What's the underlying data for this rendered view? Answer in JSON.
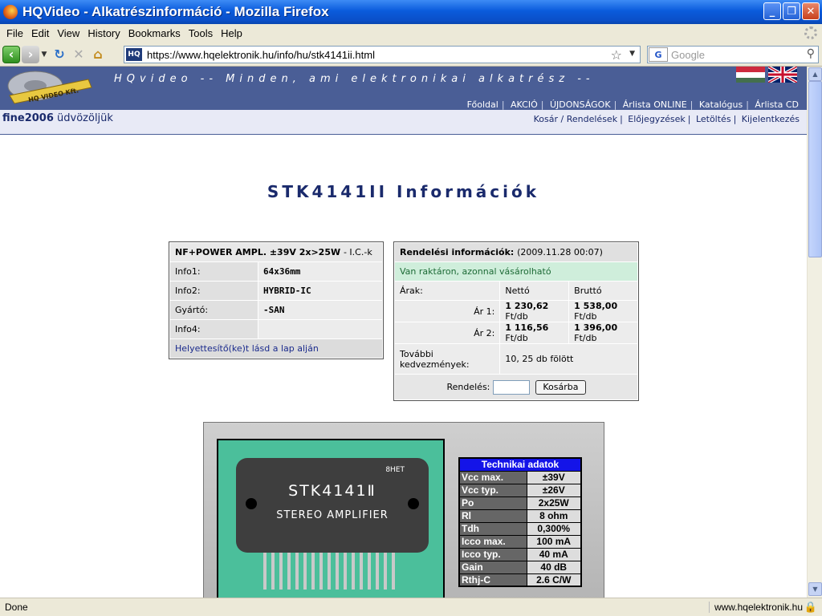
{
  "window": {
    "title": "HQVideo - Alkatrészinformáció - Mozilla Firefox",
    "minimize_icon": "minimize-icon",
    "maximize_icon": "restore-icon",
    "close_icon": "close-icon"
  },
  "menu": [
    "File",
    "Edit",
    "View",
    "History",
    "Bookmarks",
    "Tools",
    "Help"
  ],
  "toolbar": {
    "url": "https://www.hqelektronik.hu/info/hu/stk4141ii.html",
    "site_badge": "HQ",
    "search_engine": "G",
    "search_placeholder": "Google"
  },
  "site": {
    "slogan": "HQvideo -- Minden, ami elektronikai alkatrész --",
    "logo_text": "HQ VIDEO Kft.",
    "top_nav": [
      "Főoldal",
      "AKCIÓ",
      "ÚJDONSÁGOK",
      "Árlista ONLINE",
      "Katalógus",
      "Árlista CD"
    ],
    "user_name": "fine2006",
    "welcome": "üdvözöljük",
    "user_nav": [
      "Kosár / Rendelések",
      "Előjegyzések",
      "Letöltés",
      "Kijelentkezés"
    ]
  },
  "page_title": "STK4141II Információk",
  "info": {
    "header": "NF+POWER AMPL. ±39V 2x>25W",
    "header_suffix": "- I.C.-k",
    "rows": [
      {
        "label": "Info1:",
        "value": "64x36mm"
      },
      {
        "label": "Info2:",
        "value": "HYBRID-IC"
      },
      {
        "label": "Gyártó:",
        "value": "-SAN"
      },
      {
        "label": "Info4:",
        "value": ""
      }
    ],
    "link": "Helyettesítő(ke)t lásd a lap alján"
  },
  "order": {
    "header": "Rendelési információk:",
    "header_date": "(2009.11.28 00:07)",
    "stock": "Van raktáron, azonnal vásárolható",
    "prices_label": "Árak:",
    "net_label": "Nettó",
    "gross_label": "Bruttó",
    "rows": [
      {
        "label": "Ár 1:",
        "net": "1 230,62",
        "net_unit": "Ft/db",
        "gross": "1 538,00",
        "gross_unit": "Ft/db"
      },
      {
        "label": "Ár 2:",
        "net": "1 116,56",
        "net_unit": "Ft/db",
        "gross": "1 396,00",
        "gross_unit": "Ft/db"
      }
    ],
    "discount_label": "További kedvezmények:",
    "discount_value": "10, 25 db fölött",
    "order_label": "Rendelés:",
    "cart_button": "Kosárba"
  },
  "product_image": {
    "chip_text": "STK4141Ⅱ",
    "chip_subtext": "STEREO AMPLIFIER",
    "chip_code": "8HET"
  },
  "tech": {
    "header": "Technikai adatok",
    "rows": [
      {
        "k": "Vcc max.",
        "v": "±39V"
      },
      {
        "k": "Vcc typ.",
        "v": "±26V"
      },
      {
        "k": "Po",
        "v": "2x25W"
      },
      {
        "k": "Rl",
        "v": "8 ohm"
      },
      {
        "k": "Tdh",
        "v": "0,300%"
      },
      {
        "k": "Icco max.",
        "v": "100 mA"
      },
      {
        "k": "Icco typ.",
        "v": "40 mA"
      },
      {
        "k": "Gain",
        "v": "40 dB"
      },
      {
        "k": "Rthj-C",
        "v": "2.6 C/W"
      }
    ]
  },
  "status": {
    "text": "Done",
    "host": "www.hqelektronik.hu"
  },
  "colors": {
    "site_header": "#4a5e96",
    "titlebar": "#0a5bdc",
    "tech_header": "#1414e8",
    "chip_background": "#4bbf9b"
  }
}
